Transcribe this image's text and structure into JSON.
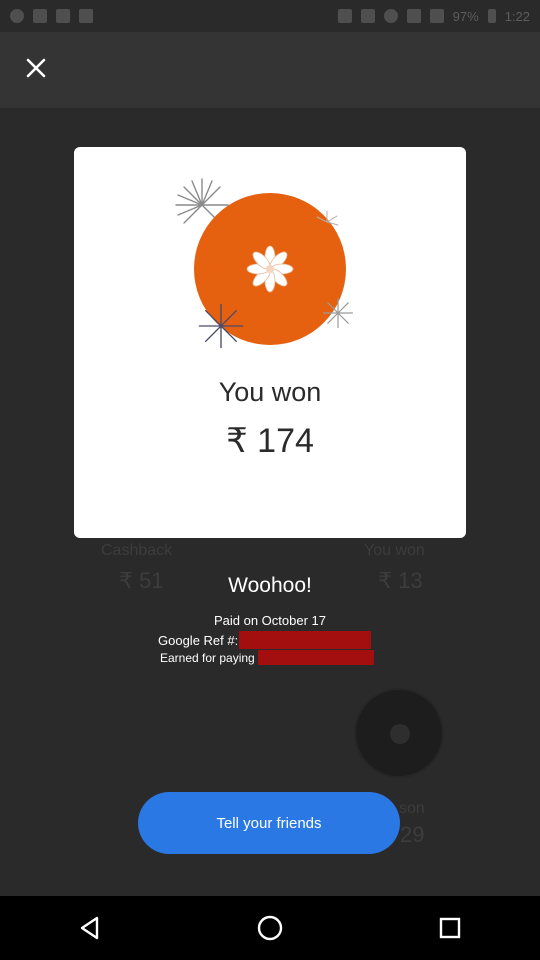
{
  "status_bar": {
    "battery": "97%",
    "time": "1:22"
  },
  "card": {
    "title": "You won",
    "amount": "₹ 174"
  },
  "background": {
    "left_label": "Cashback",
    "left_amount": "₹ 51",
    "right_label": "You won",
    "right_amount": "₹ 13",
    "lower_label": "son",
    "lower_amount": "29"
  },
  "info": {
    "headline": "Woohoo!",
    "paid_on": "Paid on October 17",
    "ref_label": "Google Ref #:",
    "earned_label": "Earned for paying"
  },
  "cta": {
    "label": "Tell your friends"
  },
  "colors": {
    "badge": "#e5600f",
    "cta": "#2a78e4",
    "redaction": "#a30f0f"
  }
}
